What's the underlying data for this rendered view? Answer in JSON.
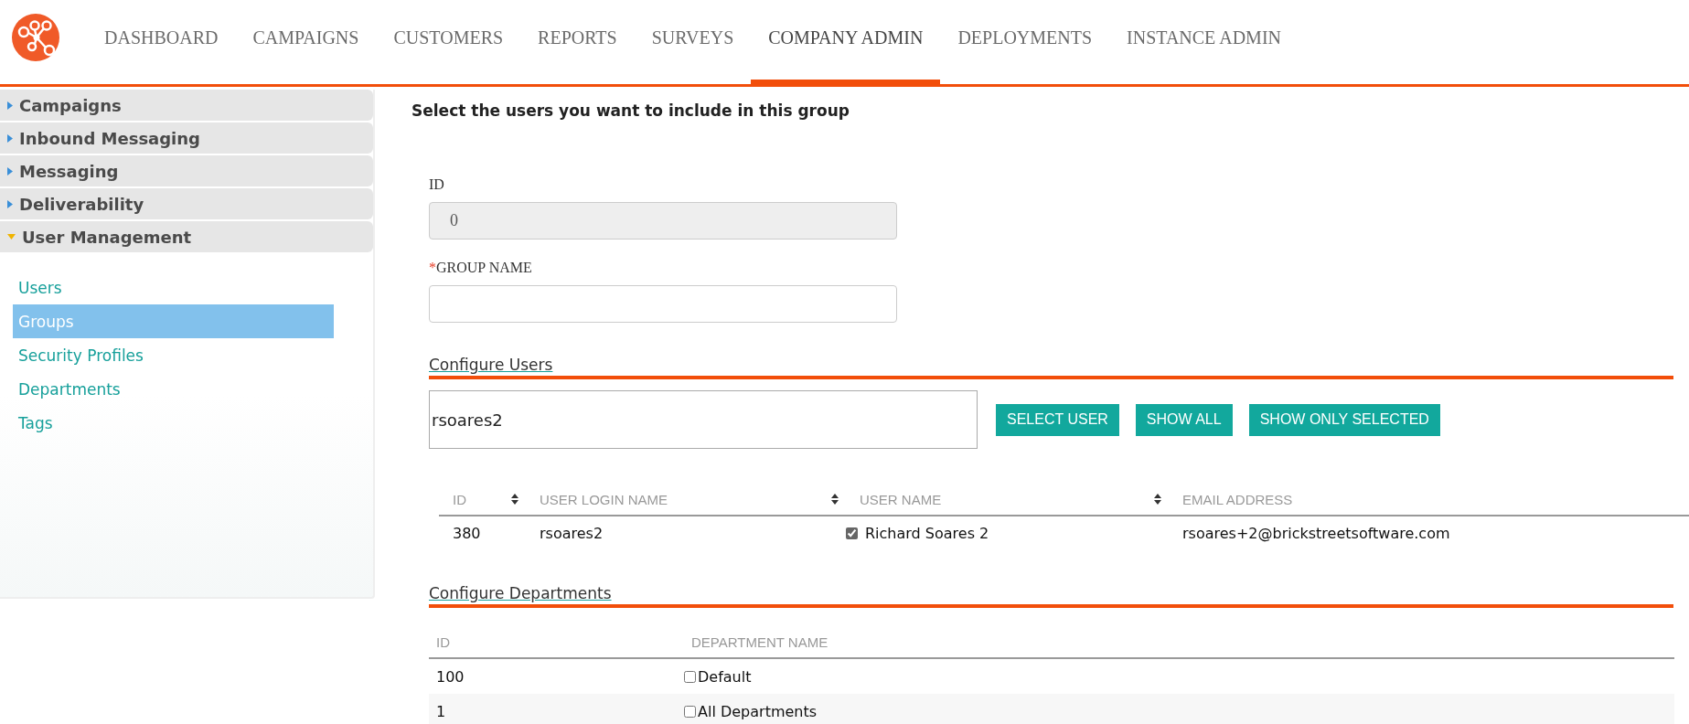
{
  "nav": {
    "tabs": [
      {
        "label": "DASHBOARD",
        "selected": false
      },
      {
        "label": "CAMPAIGNS",
        "selected": false
      },
      {
        "label": "CUSTOMERS",
        "selected": false
      },
      {
        "label": "REPORTS",
        "selected": false
      },
      {
        "label": "SURVEYS",
        "selected": false
      },
      {
        "label": "COMPANY ADMIN",
        "selected": true
      },
      {
        "label": "DEPLOYMENTS",
        "selected": false
      },
      {
        "label": "INSTANCE ADMIN",
        "selected": false
      }
    ]
  },
  "sidebar": {
    "sections": [
      {
        "label": "Campaigns",
        "expanded": false
      },
      {
        "label": "Inbound Messaging",
        "expanded": false
      },
      {
        "label": "Messaging",
        "expanded": false
      },
      {
        "label": "Deliverability",
        "expanded": false
      },
      {
        "label": "User Management",
        "expanded": true,
        "items": [
          {
            "label": "Users",
            "selected": false
          },
          {
            "label": "Groups",
            "selected": true
          },
          {
            "label": "Security Profiles",
            "selected": false
          },
          {
            "label": "Departments",
            "selected": false
          },
          {
            "label": "Tags",
            "selected": false
          }
        ]
      }
    ]
  },
  "heading": "Select the users you want to include in this group",
  "fields": [
    {
      "label": "ID",
      "value": "0",
      "disabled": true
    },
    {
      "required_mark": "*",
      "label": "GROUP NAME",
      "disabled": false
    }
  ],
  "configure_users": {
    "title": "Configure Users",
    "search_value": "rsoares2",
    "buttons": [
      "SELECT USER",
      "SHOW ALL",
      "SHOW ONLY SELECTED"
    ],
    "columns": [
      {
        "label": "ID",
        "sortable": true
      },
      {
        "label": "USER LOGIN NAME",
        "sortable": true
      },
      {
        "label": "USER NAME",
        "sortable": true
      },
      {
        "label": "EMAIL ADDRESS",
        "sortable": false
      }
    ],
    "rows": [
      {
        "id": "380",
        "login": "rsoares2",
        "name": "Richard Soares 2",
        "checked": true,
        "email": "rsoares+2@brickstreetsoftware.com"
      }
    ]
  },
  "configure_departments": {
    "title": "Configure Departments",
    "columns": [
      "ID",
      "DEPARTMENT NAME"
    ],
    "rows": [
      {
        "id": "100",
        "name": "Default",
        "checked": false
      },
      {
        "id": "1",
        "name": "All Departments",
        "checked": false
      }
    ]
  }
}
